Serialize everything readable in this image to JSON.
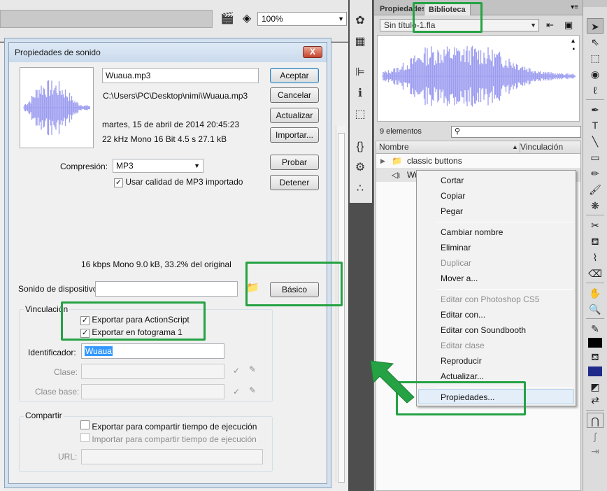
{
  "toolbar": {
    "zoom": "100%"
  },
  "dialog": {
    "title": "Propiedades de sonido",
    "close": "X",
    "filename": "Wuaua.mp3",
    "path": "C:\\Users\\PC\\Desktop\\nimi\\Wuaua.mp3",
    "date": "martes, 15 de abril de 2014  20:45:23",
    "format": "22 kHz Mono 16 Bit 4.5 s 27.1 kB",
    "buttons": {
      "accept": "Aceptar",
      "cancel": "Cancelar",
      "update": "Actualizar",
      "import": "Importar...",
      "test": "Probar",
      "stop": "Detener",
      "basic": "Básico"
    },
    "compression_label": "Compresión:",
    "compression_value": "MP3",
    "use_mp3_quality": "Usar calidad de MP3 importado",
    "stats": "16 kbps  Mono 9.0 kB, 33.2% del original",
    "device_sound_label": "Sonido de dispositivo:",
    "linkage": {
      "title": "Vinculación",
      "export_as": "Exportar para ActionScript",
      "export_frame": "Exportar en fotograma 1",
      "identifier_label": "Identificador:",
      "identifier_value": "Wuaua",
      "class_label": "Clase:",
      "base_class_label": "Clase base:"
    },
    "sharing": {
      "title": "Compartir",
      "export_runtime": "Exportar para compartir tiempo de ejecución",
      "import_runtime": "Importar para compartir tiempo de ejecución",
      "url_label": "URL:"
    }
  },
  "library": {
    "tabs": [
      "Propiedades",
      "Biblioteca"
    ],
    "document": "Sin título-1.fla",
    "count": "9 elementos",
    "columns": {
      "name": "Nombre",
      "linkage": "Vinculación"
    },
    "items": [
      {
        "name": "classic buttons"
      },
      {
        "name": "Wu"
      }
    ],
    "context_menu": {
      "items": [
        {
          "label": "Cortar",
          "enabled": true
        },
        {
          "label": "Copiar",
          "enabled": true
        },
        {
          "label": "Pegar",
          "enabled": true
        },
        {
          "label": "Cambiar nombre",
          "enabled": true
        },
        {
          "label": "Eliminar",
          "enabled": true
        },
        {
          "label": "Duplicar",
          "enabled": false
        },
        {
          "label": "Mover a...",
          "enabled": true
        },
        {
          "label": "Editar con Photoshop CS5",
          "enabled": false
        },
        {
          "label": "Editar con...",
          "enabled": true
        },
        {
          "label": "Editar con Soundbooth",
          "enabled": true
        },
        {
          "label": "Editar clase",
          "enabled": false
        },
        {
          "label": "Reproducir",
          "enabled": true
        },
        {
          "label": "Actualizar...",
          "enabled": true
        },
        {
          "label": "Propiedades...",
          "enabled": true
        }
      ]
    }
  },
  "colors": {
    "highlight": "#25a244",
    "waveform": "#9c9cf0"
  }
}
